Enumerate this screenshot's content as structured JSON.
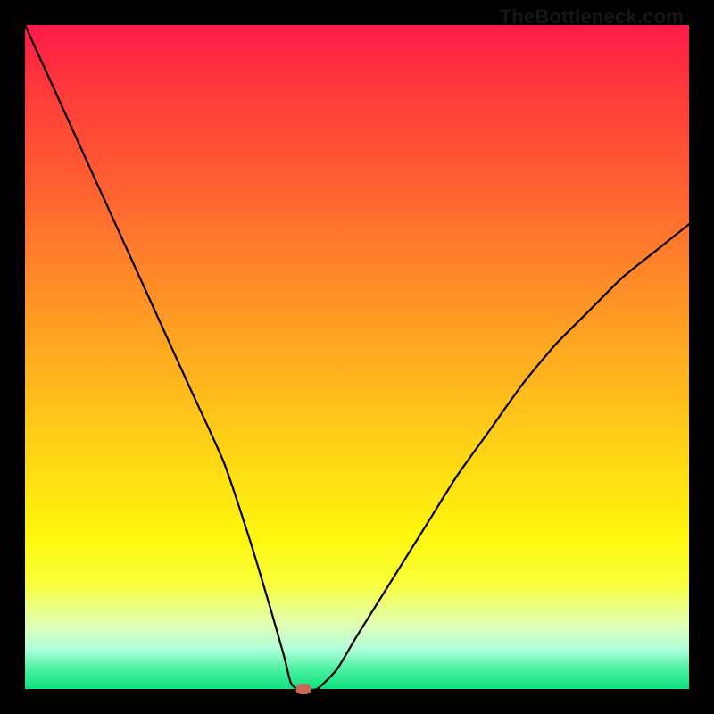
{
  "watermark": "TheBottleneck.com",
  "chart_data": {
    "type": "line",
    "title": "",
    "xlabel": "",
    "ylabel": "",
    "xlim": [
      0,
      100
    ],
    "ylim": [
      0,
      100
    ],
    "grid": false,
    "legend": false,
    "series": [
      {
        "name": "bottleneck-curve",
        "x": [
          0,
          5,
          10,
          15,
          20,
          25,
          30,
          34,
          37,
          39,
          40,
          41,
          42,
          44,
          47,
          50,
          55,
          60,
          65,
          70,
          75,
          80,
          85,
          90,
          95,
          100
        ],
        "values": [
          100,
          89,
          78,
          67,
          56,
          45,
          34,
          22,
          12,
          5,
          1,
          0,
          0,
          0,
          3,
          8,
          16,
          24,
          32,
          39,
          46,
          52,
          57,
          62,
          66,
          70
        ]
      }
    ],
    "marker": {
      "x": 42,
      "y": 0,
      "color": "#c56a56"
    },
    "background_gradient": [
      "#ff1a4a",
      "#ffba1c",
      "#fff70c",
      "#0ee080"
    ]
  }
}
